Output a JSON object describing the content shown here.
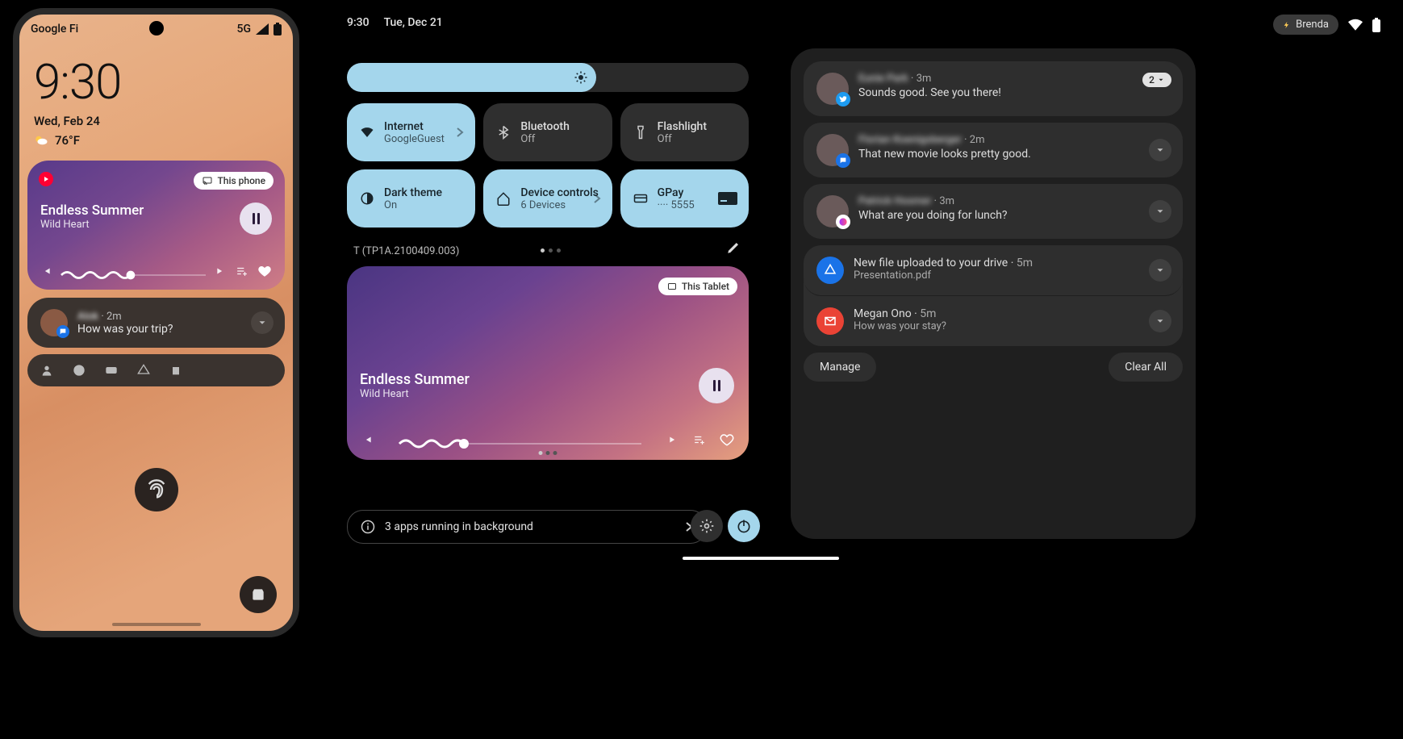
{
  "phone": {
    "carrier": "Google Fi",
    "network": "5G",
    "time": "9:30",
    "date": "Wed, Feb 24",
    "weather": "76°F",
    "media": {
      "title": "Endless Summer",
      "artist": "Wild Heart",
      "cast": "This phone"
    },
    "notif": {
      "sender": "Alok",
      "time": "2m",
      "body": "How was your trip?"
    }
  },
  "tablet": {
    "time": "9:30",
    "date": "Tue, Dec 21",
    "user": "Brenda",
    "build": "T (TP1A.2100409.003)",
    "tiles": [
      {
        "title": "Internet",
        "sub": "GoogleGuest"
      },
      {
        "title": "Bluetooth",
        "sub": "Off"
      },
      {
        "title": "Flashlight",
        "sub": "Off"
      },
      {
        "title": "Dark theme",
        "sub": "On"
      },
      {
        "title": "Device controls",
        "sub": "6 Devices"
      },
      {
        "title": "GPay",
        "sub": "···· 5555"
      }
    ],
    "media": {
      "title": "Endless Summer",
      "artist": "Wild Heart",
      "cast": "This Tablet"
    },
    "running": "3 apps running in background"
  },
  "shade": {
    "items": [
      {
        "sender": "Eunie Park",
        "time": "3m",
        "body": "Sounds good. See you there!",
        "count": "2"
      },
      {
        "sender": "Florian Koenigsberger",
        "time": "2m",
        "body": "That new movie looks pretty good."
      },
      {
        "sender": "Patrick Hosmer",
        "time": "3m",
        "body": "What are you doing for lunch?"
      },
      {
        "title": "New file uploaded to your drive",
        "time": "5m",
        "body": "Presentation.pdf"
      },
      {
        "sender": "Megan Ono",
        "time": "5m",
        "body": "How was your stay?"
      }
    ],
    "manage": "Manage",
    "clear": "Clear All"
  }
}
